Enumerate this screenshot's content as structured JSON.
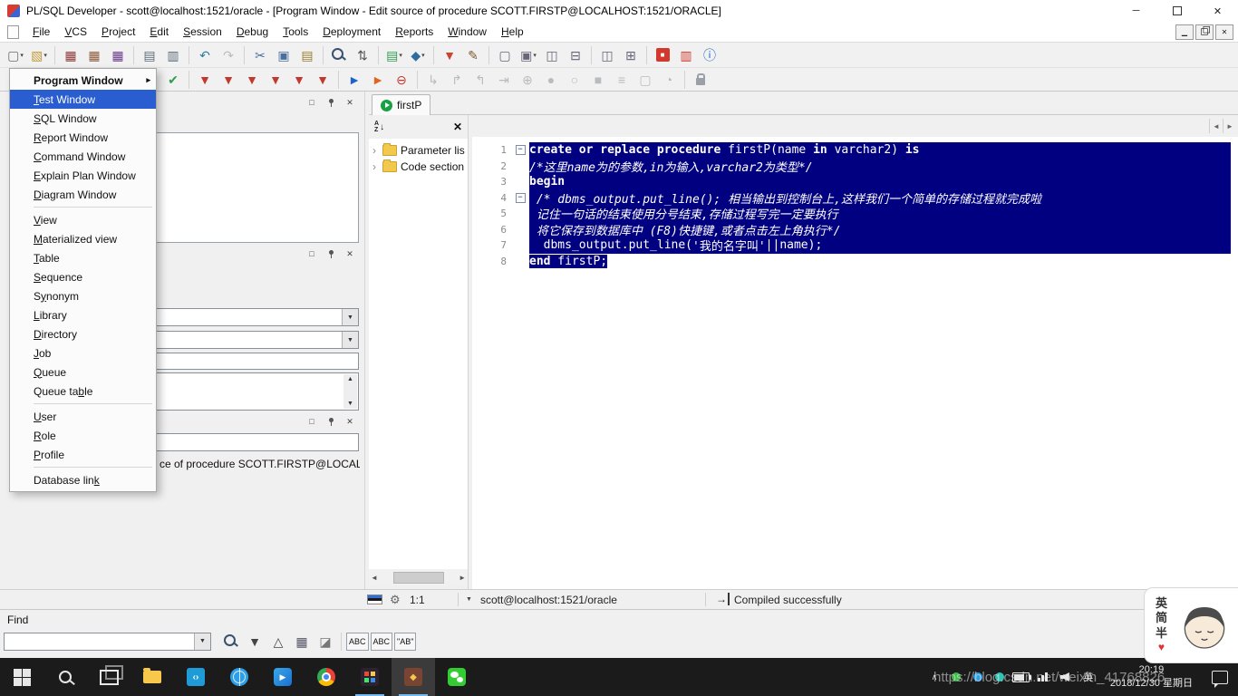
{
  "titlebar": {
    "title": "PL/SQL Developer - scott@localhost:1521/oracle - [Program Window - Edit source of procedure SCOTT.FIRSTP@LOCALHOST:1521/ORACLE]"
  },
  "menubar": {
    "items": [
      {
        "label": "File",
        "u": 0
      },
      {
        "label": "VCS",
        "u": 0
      },
      {
        "label": "Project",
        "u": 0
      },
      {
        "label": "Edit",
        "u": 0
      },
      {
        "label": "Session",
        "u": 0
      },
      {
        "label": "Debug",
        "u": 0
      },
      {
        "label": "Tools",
        "u": 0
      },
      {
        "label": "Deployment",
        "u": 0
      },
      {
        "label": "Reports",
        "u": 0
      },
      {
        "label": "Window",
        "u": 0
      },
      {
        "label": "Help",
        "u": 0
      }
    ]
  },
  "toolbar1": [
    {
      "n": "new-document-button",
      "g": "▢",
      "c": "#6b6b6b",
      "dd": true
    },
    {
      "n": "open-file-button",
      "g": "▧",
      "c": "#c49a3a",
      "dd": true
    },
    {
      "sep": true
    },
    {
      "n": "save-button",
      "g": "▦",
      "c": "#8c3a3a"
    },
    {
      "n": "save-as-button",
      "g": "▦",
      "c": "#8c5a3a"
    },
    {
      "n": "save-all-button",
      "g": "▦",
      "c": "#6b3a8c"
    },
    {
      "sep": true
    },
    {
      "n": "print-button",
      "g": "▤",
      "c": "#5a6b7a"
    },
    {
      "n": "print-preview-button",
      "g": "▥",
      "c": "#5a6b7a"
    },
    {
      "sep": true
    },
    {
      "n": "undo-button",
      "g": "↶",
      "c": "#2e7d9e"
    },
    {
      "n": "redo-button",
      "g": "↷",
      "c": "#9aa4ab",
      "dis": true
    },
    {
      "sep": true
    },
    {
      "n": "cut-button",
      "g": "✂",
      "c": "#4a6f9e"
    },
    {
      "n": "copy-button",
      "g": "▣",
      "c": "#4a6f9e"
    },
    {
      "n": "paste-button",
      "g": "▤",
      "c": "#9a7d2e"
    },
    {
      "sep": true
    },
    {
      "n": "find-button",
      "css": "mag"
    },
    {
      "n": "sort-toolbar-button",
      "g": "⇅",
      "c": "#555555"
    },
    {
      "sep": true
    },
    {
      "n": "describe-dropdown-button",
      "g": "▤",
      "c": "#2f9e50",
      "dd": true
    },
    {
      "n": "browser-dropdown-button",
      "g": "◆",
      "c": "#2e6d9e",
      "dd": true
    },
    {
      "sep": true
    },
    {
      "n": "filter-button",
      "g": "▼",
      "c": "#c8452e"
    },
    {
      "n": "edit-data-button",
      "g": "✎",
      "c": "#7a5a2e"
    },
    {
      "sep": true
    },
    {
      "n": "window-new-button",
      "g": "▢",
      "c": "#666677"
    },
    {
      "n": "window-cascade-dropdown",
      "g": "▣",
      "c": "#666677",
      "dd": true
    },
    {
      "n": "window-tile-horizontal-button",
      "g": "◫",
      "c": "#666677"
    },
    {
      "n": "window-tile-vertical-button",
      "g": "⊟",
      "c": "#666677"
    },
    {
      "sep": true
    },
    {
      "n": "copy-screen-button",
      "g": "◫",
      "c": "#666677"
    },
    {
      "n": "grid-button",
      "g": "⊞",
      "c": "#666677"
    },
    {
      "sep": true
    },
    {
      "n": "stop-refresh-button",
      "g": "■",
      "c": "#ffffff",
      "bg": "#d2382c"
    },
    {
      "n": "timer-button",
      "g": "▥",
      "c": "#d2382c"
    },
    {
      "n": "help-info-button",
      "g": "ⓘ",
      "c": "#1d5fbf"
    }
  ],
  "toolbar2": [
    {
      "n": "edit-dropdown-button",
      "g": "✎",
      "c": "#6b6b6b",
      "dd": true
    },
    {
      "sep": true
    },
    {
      "n": "session-commit-button",
      "g": "▤",
      "c": "#2f9e50"
    },
    {
      "n": "session-rollback-button",
      "g": "▤",
      "c": "#2f9e50"
    },
    {
      "n": "session-log-button",
      "g": "▤",
      "c": "#2f9e50"
    },
    {
      "sep": true
    },
    {
      "n": "validate-button",
      "g": "◆",
      "c": "#c23b2e"
    },
    {
      "n": "object-browser-button",
      "g": "◆",
      "c": "#2e9e9e"
    },
    {
      "n": "syntax-check-button",
      "g": "✔",
      "c": "#2f9e50"
    },
    {
      "sep": true
    },
    {
      "n": "beautifier-button",
      "g": "▼",
      "c": "#c2382c"
    },
    {
      "n": "beautifier-options-button",
      "g": "▼",
      "c": "#c2382c"
    },
    {
      "n": "macro-record-button",
      "g": "▼",
      "c": "#c2382c"
    },
    {
      "n": "macro-play-button",
      "g": "▼",
      "c": "#c2382c"
    },
    {
      "n": "snippets-button",
      "g": "▼",
      "c": "#c2382c"
    },
    {
      "n": "templates-button",
      "g": "▼",
      "c": "#c2382c"
    },
    {
      "sep": true
    },
    {
      "n": "execute-button",
      "g": "►",
      "c": "#1f63c8"
    },
    {
      "n": "execute-record-button",
      "g": "►",
      "c": "#e0641f"
    },
    {
      "n": "break-button",
      "g": "⊖",
      "c": "#c2382c"
    },
    {
      "sep": true
    },
    {
      "n": "step-into-button",
      "g": "↳",
      "dis": true
    },
    {
      "n": "step-over-button",
      "g": "↱",
      "dis": true
    },
    {
      "n": "step-out-button",
      "g": "↰",
      "dis": true
    },
    {
      "n": "run-to-cursor-button",
      "g": "⇥",
      "dis": true
    },
    {
      "n": "add-watch-button",
      "g": "⊕",
      "dis": true
    },
    {
      "n": "toggle-breakpoint-button",
      "g": "●",
      "dis": true
    },
    {
      "n": "clear-breakpoints-button",
      "g": "○",
      "dis": true
    },
    {
      "n": "stop-debug-button",
      "g": "■",
      "dis": true
    },
    {
      "n": "output-button",
      "g": "≡",
      "dis": true
    },
    {
      "n": "messages-button",
      "g": "▢",
      "dis": true
    },
    {
      "n": "profiler-button",
      "g": "◔",
      "dis": true
    },
    {
      "sep": true
    },
    {
      "n": "lock-button",
      "css": "lock"
    }
  ],
  "menu": {
    "items": [
      {
        "label": "Program Window",
        "submenu": true,
        "bold": true
      },
      {
        "label": "Test Window",
        "selected": true,
        "u": 0
      },
      {
        "label": "SQL Window",
        "u": 0
      },
      {
        "label": "Report Window",
        "u": 0
      },
      {
        "label": "Command Window",
        "u": 0
      },
      {
        "label": "Explain Plan Window",
        "u": 0
      },
      {
        "label": "Diagram Window",
        "u": 0
      },
      {
        "sep": true
      },
      {
        "label": "View",
        "u": 0
      },
      {
        "label": "Materialized view",
        "u": 0
      },
      {
        "label": "Table",
        "u": 0
      },
      {
        "label": "Sequence",
        "u": 0
      },
      {
        "label": "Synonym",
        "u": 1
      },
      {
        "label": "Library",
        "u": 0
      },
      {
        "label": "Directory",
        "u": 0
      },
      {
        "label": "Job",
        "u": 0
      },
      {
        "label": "Queue",
        "u": 0
      },
      {
        "label": "Queue table",
        "u": 8
      },
      {
        "sep": true
      },
      {
        "label": "User",
        "u": 0
      },
      {
        "label": "Role",
        "u": 0
      },
      {
        "label": "Profile",
        "u": 0
      },
      {
        "sep": true
      },
      {
        "label": "Database link",
        "u": 12
      }
    ]
  },
  "dock": {
    "caption_fragment": "ce of procedure SCOTT.FIRSTP@LOCALHO"
  },
  "program_window": {
    "tab": {
      "label": "firstP"
    },
    "tree": {
      "items": [
        "Parameter lis",
        "Code section"
      ]
    },
    "editor": {
      "lines": [
        {
          "num": 1,
          "fold": true,
          "sel": "full",
          "segs": [
            {
              "t": "create or replace procedure ",
              "b": true
            },
            {
              "t": "firstP("
            },
            {
              "t": "name "
            },
            {
              "t": "in ",
              "b": true
            },
            {
              "t": "varchar2) "
            },
            {
              "t": "is",
              "b": true
            }
          ]
        },
        {
          "num": 2,
          "sel": "full",
          "segs": [
            {
              "t": "/*这里name为的参数,in为输入,varchar2为类型*/",
              "i": true
            }
          ]
        },
        {
          "num": 3,
          "sel": "full",
          "segs": [
            {
              "t": "begin",
              "b": true
            }
          ]
        },
        {
          "num": 4,
          "fold": true,
          "sel": "full",
          "segs": [
            {
              "t": " /* dbms_output.put_line(); 相当输出到控制台上,这样我们一个简单的存储过程就完成啦",
              "i": true
            }
          ]
        },
        {
          "num": 5,
          "sel": "full",
          "segs": [
            {
              "t": " 记住一句话的结束使用分号结束,存储过程写完一定要执行",
              "i": true
            }
          ]
        },
        {
          "num": 6,
          "sel": "full",
          "segs": [
            {
              "t": " 将它保存到数据库中 (F8)快捷键,或者点击左上角执行*/",
              "i": true
            }
          ]
        },
        {
          "num": 7,
          "sel": "full",
          "segs": [
            {
              "t": "  dbms_output.put_line("
            },
            {
              "t": "'我的名字叫'"
            },
            {
              "t": "||name);"
            }
          ]
        },
        {
          "num": 8,
          "sel": "text",
          "segs": [
            {
              "t": "end",
              "b": true
            },
            {
              "t": " firstP;"
            }
          ]
        }
      ]
    }
  },
  "statusbar": {
    "position": "1:1",
    "connection": "scott@localhost:1521/oracle",
    "message": "Compiled successfully"
  },
  "find": {
    "label": "Find",
    "icons": [
      {
        "n": "find-next-button",
        "css": "mag"
      },
      {
        "n": "direction-down-button",
        "g": "▼",
        "c": "#444444"
      },
      {
        "n": "direction-up-button",
        "g": "△",
        "c": "#444444"
      },
      {
        "n": "mark-all-button",
        "g": "▦",
        "c": "#555566"
      },
      {
        "n": "clear-highlight-button",
        "g": "◪",
        "c": "#777777"
      },
      {
        "sep": true
      },
      {
        "n": "match-case-toggle",
        "txt": "ABC"
      },
      {
        "n": "whole-word-toggle",
        "txt": "ABC"
      },
      {
        "n": "regex-toggle",
        "txt": "\"AB\""
      }
    ]
  },
  "taskbar": {
    "apps": [
      {
        "n": "start-button",
        "kind": "win"
      },
      {
        "n": "search-button",
        "kind": "mag"
      },
      {
        "n": "task-view-button",
        "kind": "tview"
      },
      {
        "n": "file-explorer-button",
        "kind": "folder"
      },
      {
        "n": "code-editor-app-button",
        "kind": "vscode"
      },
      {
        "n": "browser-app-button",
        "kind": "globe"
      },
      {
        "n": "media-player-app-button",
        "kind": "play"
      },
      {
        "n": "chrome-button",
        "kind": "chrome"
      },
      {
        "n": "game-app-button",
        "kind": "game",
        "run": true
      },
      {
        "n": "plsql-developer-app-button",
        "kind": "plsql",
        "run": true,
        "active": true
      },
      {
        "n": "wechat-button",
        "kind": "wechat"
      }
    ],
    "tray": {
      "lang": "英",
      "time": "20:19",
      "date": "2018/12/30 星期日"
    }
  },
  "watermark": "https://blog.csdn.net/weixin_41768826",
  "sticker": {
    "chars": [
      "英",
      "简",
      "半"
    ],
    "heart": "♥"
  }
}
